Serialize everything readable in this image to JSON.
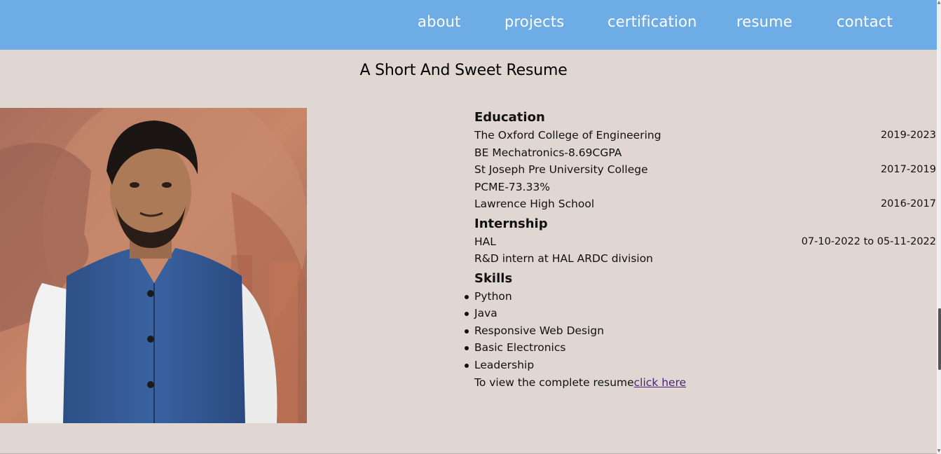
{
  "nav": {
    "items": [
      {
        "label": "about"
      },
      {
        "label": "projects"
      },
      {
        "label": "certification"
      },
      {
        "label": "resume"
      },
      {
        "label": "contact"
      }
    ]
  },
  "page": {
    "title": "A Short And Sweet Resume"
  },
  "colors": {
    "nav_bg": "#6eace6",
    "page_bg": "#e0d6d2",
    "link": "#4a2280"
  },
  "education": {
    "heading": "Education",
    "rows": [
      {
        "text": "The Oxford College of Engineering",
        "date": "2019-2023"
      },
      {
        "text": "BE Mechatronics-8.69CGPA",
        "date": ""
      },
      {
        "text": "St Joseph Pre University College",
        "date": "2017-2019"
      },
      {
        "text": "PCME-73.33%",
        "date": ""
      },
      {
        "text": "Lawrence High School",
        "date": "2016-2017"
      }
    ]
  },
  "internship": {
    "heading": "Internship",
    "rows": [
      {
        "text": "HAL",
        "date": "07-10-2022 to 05-11-2022"
      },
      {
        "text": "R&D intern at HAL ARDC division",
        "date": ""
      }
    ]
  },
  "skills": {
    "heading": "Skills",
    "items": [
      "Python",
      "Java",
      "Responsive Web Design",
      "Basic Electronics",
      "Leadership"
    ]
  },
  "footer": {
    "text": "To view the complete resume",
    "link_label": "click here"
  }
}
